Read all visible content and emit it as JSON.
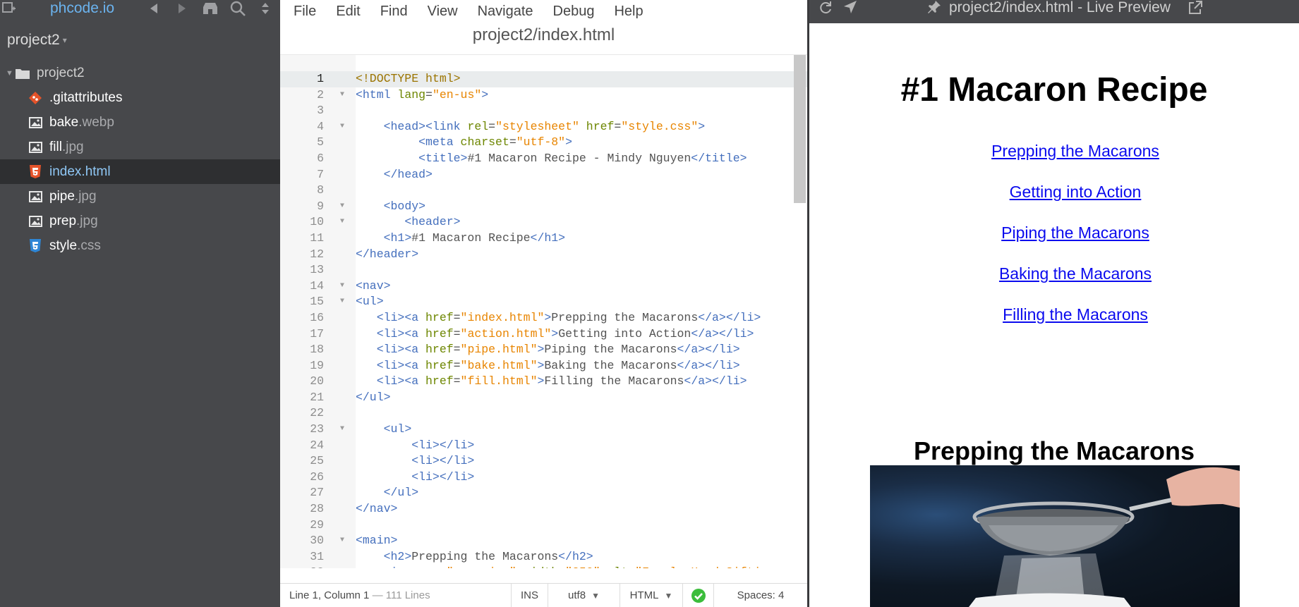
{
  "sidebar": {
    "brand": "phcode.io",
    "project_title": "project2",
    "root": "project2",
    "files": [
      {
        "name": ".gitattributes",
        "ext": "",
        "icon": "git-icon"
      },
      {
        "name": "bake",
        "ext": ".webp",
        "icon": "image-icon"
      },
      {
        "name": "fill",
        "ext": ".jpg",
        "icon": "image-icon"
      },
      {
        "name": "index",
        "ext": ".html",
        "icon": "html5-icon",
        "selected": true
      },
      {
        "name": "pipe",
        "ext": ".jpg",
        "icon": "image-icon"
      },
      {
        "name": "prep",
        "ext": ".jpg",
        "icon": "image-icon"
      },
      {
        "name": "style",
        "ext": ".css",
        "icon": "css3-icon"
      }
    ]
  },
  "editor": {
    "menu": [
      "File",
      "Edit",
      "Find",
      "View",
      "Navigate",
      "Debug",
      "Help"
    ],
    "file_title": "project2/index.html",
    "status": {
      "cursor": "Line 1, Column 1",
      "lines": "— 111 Lines",
      "mode": "INS",
      "encoding": "utf8",
      "language": "HTML",
      "spaces": "Spaces:  4"
    }
  },
  "preview": {
    "title": "project2/index.html - Live Preview",
    "h1": "#1 Macaron Recipe",
    "links": [
      "Prepping the Macarons",
      "Getting into Action",
      "Piping the Macarons",
      "Baking the Macarons",
      "Filling the Macarons"
    ],
    "h2": "Prepping the Macarons"
  },
  "colors": {
    "sidebar_bg": "#47484b",
    "selected_bg": "#2e2f31",
    "tag": "#446fbd",
    "attr": "#6d8600",
    "value": "#e88501",
    "link": "#0a0aee"
  },
  "code_lines": [
    [
      [
        "doc",
        "<!DOCTYPE html>"
      ]
    ],
    [
      [
        "tag",
        "<html "
      ],
      [
        "attr",
        "lang"
      ],
      [
        "txt",
        "="
      ],
      [
        "val",
        "\"en-us\""
      ],
      [
        "tag",
        ">"
      ]
    ],
    [],
    [
      [
        "txt",
        "    "
      ],
      [
        "tag",
        "<head><link "
      ],
      [
        "attr",
        "rel"
      ],
      [
        "txt",
        "="
      ],
      [
        "val",
        "\"stylesheet\""
      ],
      [
        "txt",
        " "
      ],
      [
        "attr",
        "href"
      ],
      [
        "txt",
        "="
      ],
      [
        "val",
        "\"style.css\""
      ],
      [
        "tag",
        ">"
      ]
    ],
    [
      [
        "txt",
        "         "
      ],
      [
        "tag",
        "<meta "
      ],
      [
        "attr",
        "charset"
      ],
      [
        "txt",
        "="
      ],
      [
        "val",
        "\"utf-8\""
      ],
      [
        "tag",
        ">"
      ]
    ],
    [
      [
        "txt",
        "         "
      ],
      [
        "tag",
        "<title>"
      ],
      [
        "txt",
        "#1 Macaron Recipe - Mindy Nguyen"
      ],
      [
        "tag",
        "</title>"
      ]
    ],
    [
      [
        "txt",
        "    "
      ],
      [
        "tag",
        "</head>"
      ]
    ],
    [],
    [
      [
        "txt",
        "    "
      ],
      [
        "tag",
        "<body>"
      ]
    ],
    [
      [
        "txt",
        "       "
      ],
      [
        "tag",
        "<header>"
      ]
    ],
    [
      [
        "txt",
        "    "
      ],
      [
        "tag",
        "<h1>"
      ],
      [
        "txt",
        "#1 Macaron Recipe"
      ],
      [
        "tag",
        "</h1>"
      ]
    ],
    [
      [
        "tag",
        "</header>"
      ]
    ],
    [],
    [
      [
        "tag",
        "<nav>"
      ]
    ],
    [
      [
        "tag",
        "<ul>"
      ]
    ],
    [
      [
        "txt",
        "   "
      ],
      [
        "tag",
        "<li><a "
      ],
      [
        "attr",
        "href"
      ],
      [
        "txt",
        "="
      ],
      [
        "val",
        "\"index.html\""
      ],
      [
        "tag",
        ">"
      ],
      [
        "txt",
        "Prepping the Macarons"
      ],
      [
        "tag",
        "</a></li>"
      ]
    ],
    [
      [
        "txt",
        "   "
      ],
      [
        "tag",
        "<li><a "
      ],
      [
        "attr",
        "href"
      ],
      [
        "txt",
        "="
      ],
      [
        "val",
        "\"action.html\""
      ],
      [
        "tag",
        ">"
      ],
      [
        "txt",
        "Getting into Action"
      ],
      [
        "tag",
        "</a></li>"
      ]
    ],
    [
      [
        "txt",
        "   "
      ],
      [
        "tag",
        "<li><a "
      ],
      [
        "attr",
        "href"
      ],
      [
        "txt",
        "="
      ],
      [
        "val",
        "\"pipe.html\""
      ],
      [
        "tag",
        ">"
      ],
      [
        "txt",
        "Piping the Macarons"
      ],
      [
        "tag",
        "</a></li>"
      ]
    ],
    [
      [
        "txt",
        "   "
      ],
      [
        "tag",
        "<li><a "
      ],
      [
        "attr",
        "href"
      ],
      [
        "txt",
        "="
      ],
      [
        "val",
        "\"bake.html\""
      ],
      [
        "tag",
        ">"
      ],
      [
        "txt",
        "Baking the Macarons"
      ],
      [
        "tag",
        "</a></li>"
      ]
    ],
    [
      [
        "txt",
        "   "
      ],
      [
        "tag",
        "<li><a "
      ],
      [
        "attr",
        "href"
      ],
      [
        "txt",
        "="
      ],
      [
        "val",
        "\"fill.html\""
      ],
      [
        "tag",
        ">"
      ],
      [
        "txt",
        "Filling the Macarons"
      ],
      [
        "tag",
        "</a></li>"
      ]
    ],
    [
      [
        "tag",
        "</ul>"
      ]
    ],
    [],
    [
      [
        "txt",
        "    "
      ],
      [
        "tag",
        "<ul>"
      ]
    ],
    [
      [
        "txt",
        "        "
      ],
      [
        "tag",
        "<li></li>"
      ]
    ],
    [
      [
        "txt",
        "        "
      ],
      [
        "tag",
        "<li></li>"
      ]
    ],
    [
      [
        "txt",
        "        "
      ],
      [
        "tag",
        "<li></li>"
      ]
    ],
    [
      [
        "txt",
        "    "
      ],
      [
        "tag",
        "</ul>"
      ]
    ],
    [
      [
        "tag",
        "</nav>"
      ]
    ],
    [],
    [
      [
        "tag",
        "<main>"
      ]
    ],
    [
      [
        "txt",
        "    "
      ],
      [
        "tag",
        "<h2>"
      ],
      [
        "txt",
        "Prepping the Macarons"
      ],
      [
        "tag",
        "</h2>"
      ]
    ],
    [
      [
        "txt",
        "    "
      ],
      [
        "tag",
        "<img "
      ],
      [
        "attr",
        "src"
      ],
      [
        "txt",
        "="
      ],
      [
        "val",
        "\"prep.jpg\""
      ],
      [
        "txt",
        " "
      ],
      [
        "attr",
        "width"
      ],
      [
        "txt",
        "="
      ],
      [
        "val",
        "\"350\""
      ],
      [
        "txt",
        " "
      ],
      [
        "attr",
        "alt"
      ],
      [
        "txt",
        "="
      ],
      [
        "val",
        "\"Female Hand Sifting"
      ]
    ]
  ],
  "fold_lines": [
    2,
    4,
    9,
    10,
    14,
    15,
    23,
    30
  ]
}
